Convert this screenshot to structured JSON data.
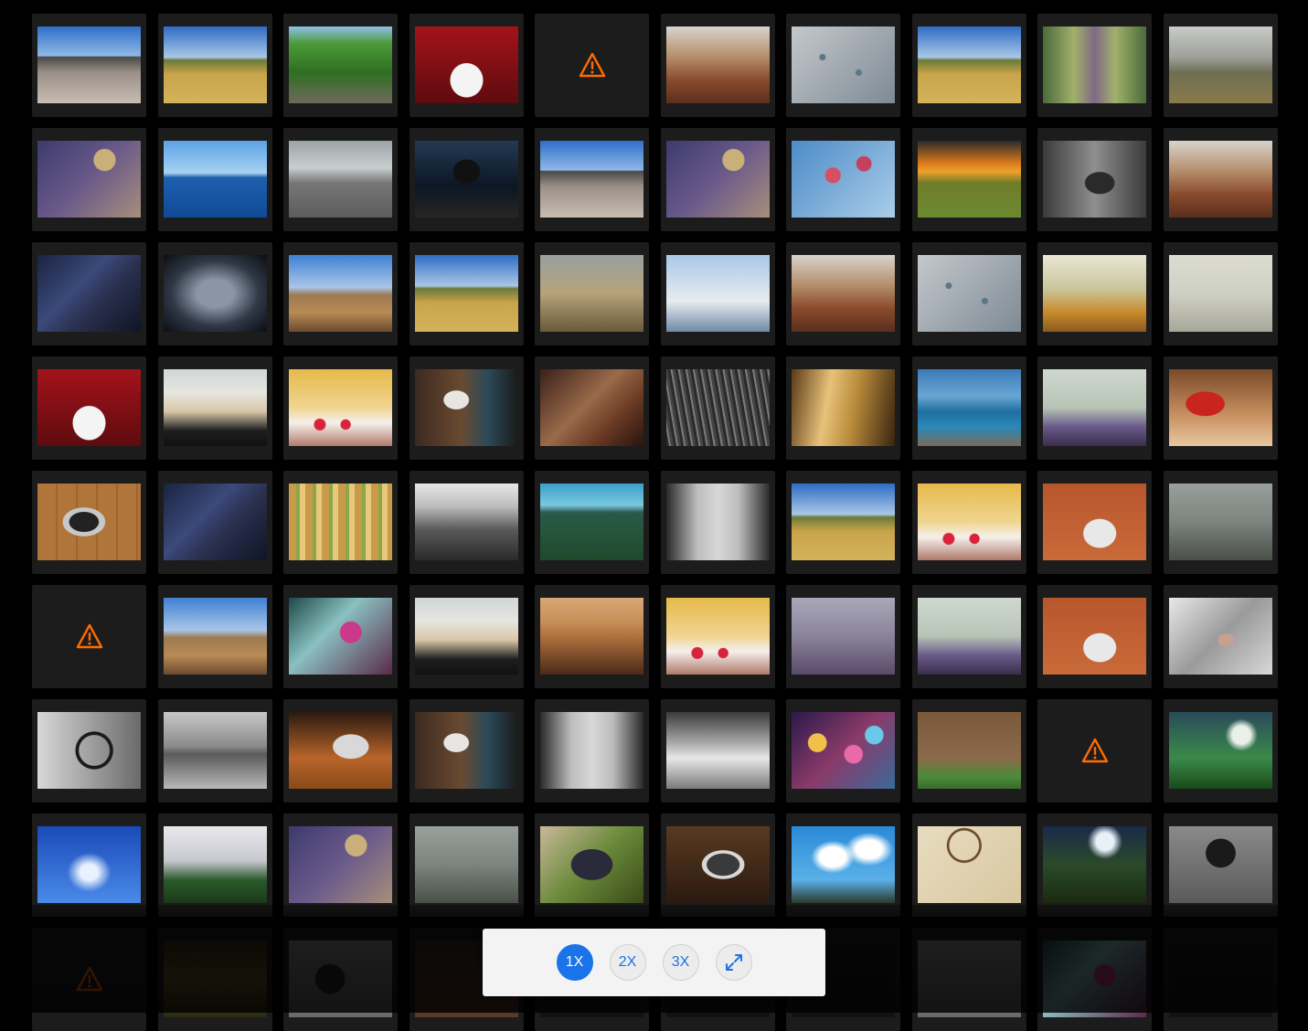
{
  "ui": {
    "accent": "#1a73e8",
    "warning_color": "#ff6b00",
    "tile_background": "#1c1c1c"
  },
  "gallery": {
    "items": [
      {
        "type": "beach"
      },
      {
        "type": "legs"
      },
      {
        "type": "forest"
      },
      {
        "type": "shoes"
      },
      {
        "type": "error"
      },
      {
        "type": "cafe"
      },
      {
        "type": "drops"
      },
      {
        "type": "legs"
      },
      {
        "type": "forest2"
      },
      {
        "type": "mountain"
      },
      {
        "type": "flower"
      },
      {
        "type": "sea"
      },
      {
        "type": "dock"
      },
      {
        "type": "controller"
      },
      {
        "type": "beach"
      },
      {
        "type": "flower"
      },
      {
        "type": "blossom"
      },
      {
        "type": "sunset"
      },
      {
        "type": "pinecone"
      },
      {
        "type": "cafe"
      },
      {
        "type": "bridge"
      },
      {
        "type": "forks"
      },
      {
        "type": "desert"
      },
      {
        "type": "legs"
      },
      {
        "type": "wheat"
      },
      {
        "type": "santorini"
      },
      {
        "type": "cafe"
      },
      {
        "type": "drops"
      },
      {
        "type": "fence"
      },
      {
        "type": "beachfog"
      },
      {
        "type": "shoes"
      },
      {
        "type": "rocks"
      },
      {
        "type": "berries"
      },
      {
        "type": "laptopman"
      },
      {
        "type": "glove"
      },
      {
        "type": "grass"
      },
      {
        "type": "sunlight"
      },
      {
        "type": "seashore"
      },
      {
        "type": "boat"
      },
      {
        "type": "mug"
      },
      {
        "type": "laptop"
      },
      {
        "type": "bridge"
      },
      {
        "type": "fencecolor"
      },
      {
        "type": "bwvalley"
      },
      {
        "type": "treesky"
      },
      {
        "type": "highway"
      },
      {
        "type": "legs"
      },
      {
        "type": "berries"
      },
      {
        "type": "desk"
      },
      {
        "type": "fogcoast"
      },
      {
        "type": "error"
      },
      {
        "type": "desert"
      },
      {
        "type": "cherry"
      },
      {
        "type": "rocks"
      },
      {
        "type": "cliff"
      },
      {
        "type": "berries"
      },
      {
        "type": "foggytree"
      },
      {
        "type": "boat"
      },
      {
        "type": "desk"
      },
      {
        "type": "cat"
      },
      {
        "type": "bwwheel"
      },
      {
        "type": "pier"
      },
      {
        "type": "laptopdesk"
      },
      {
        "type": "laptopman"
      },
      {
        "type": "highway"
      },
      {
        "type": "bwsea"
      },
      {
        "type": "bokeh"
      },
      {
        "type": "shed"
      },
      {
        "type": "error"
      },
      {
        "type": "grassgreen"
      },
      {
        "type": "skyblue"
      },
      {
        "type": "coast"
      },
      {
        "type": "flower"
      },
      {
        "type": "fogcoast"
      },
      {
        "type": "grapes"
      },
      {
        "type": "phone"
      },
      {
        "type": "clouds"
      },
      {
        "type": "dreamcatcher"
      },
      {
        "type": "meadow"
      },
      {
        "type": "workspace"
      },
      {
        "type": "error"
      },
      {
        "type": "meadowdusk"
      },
      {
        "type": "turntable"
      },
      {
        "type": "laptopdark"
      },
      {
        "type": "dark"
      },
      {
        "type": "dark"
      },
      {
        "type": "dark"
      },
      {
        "type": "tools"
      },
      {
        "type": "cherry"
      },
      {
        "type": "dark"
      }
    ]
  },
  "zoom_controls": {
    "options": [
      "1X",
      "2X",
      "3X"
    ],
    "active": "1X",
    "fullscreen_icon": "expand-icon"
  }
}
